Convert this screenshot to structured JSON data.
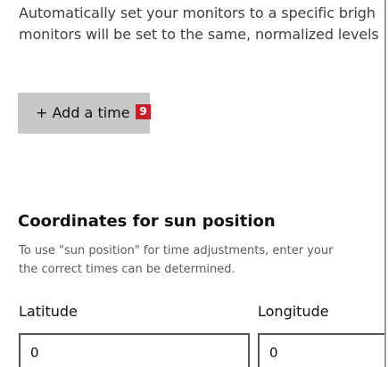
{
  "schedule": {
    "description_lines": [
      "Automatically set your monitors to a specific brigh",
      "monitors will be set to the same, normalized levels"
    ],
    "add_time_label": "+ Add a time",
    "add_time_badge": "9"
  },
  "coordinates": {
    "title": "Coordinates for sun position",
    "description_lines": [
      "To use \"sun position\" for time adjustments, enter your",
      "the correct times can be determined."
    ],
    "latitude": {
      "label": "Latitude",
      "value": "0"
    },
    "longitude": {
      "label": "Longitude",
      "value": "0"
    }
  },
  "colors": {
    "button_bg": "#c8c8c8",
    "badge_bg": "#c8202a",
    "field_border": "#555555"
  }
}
